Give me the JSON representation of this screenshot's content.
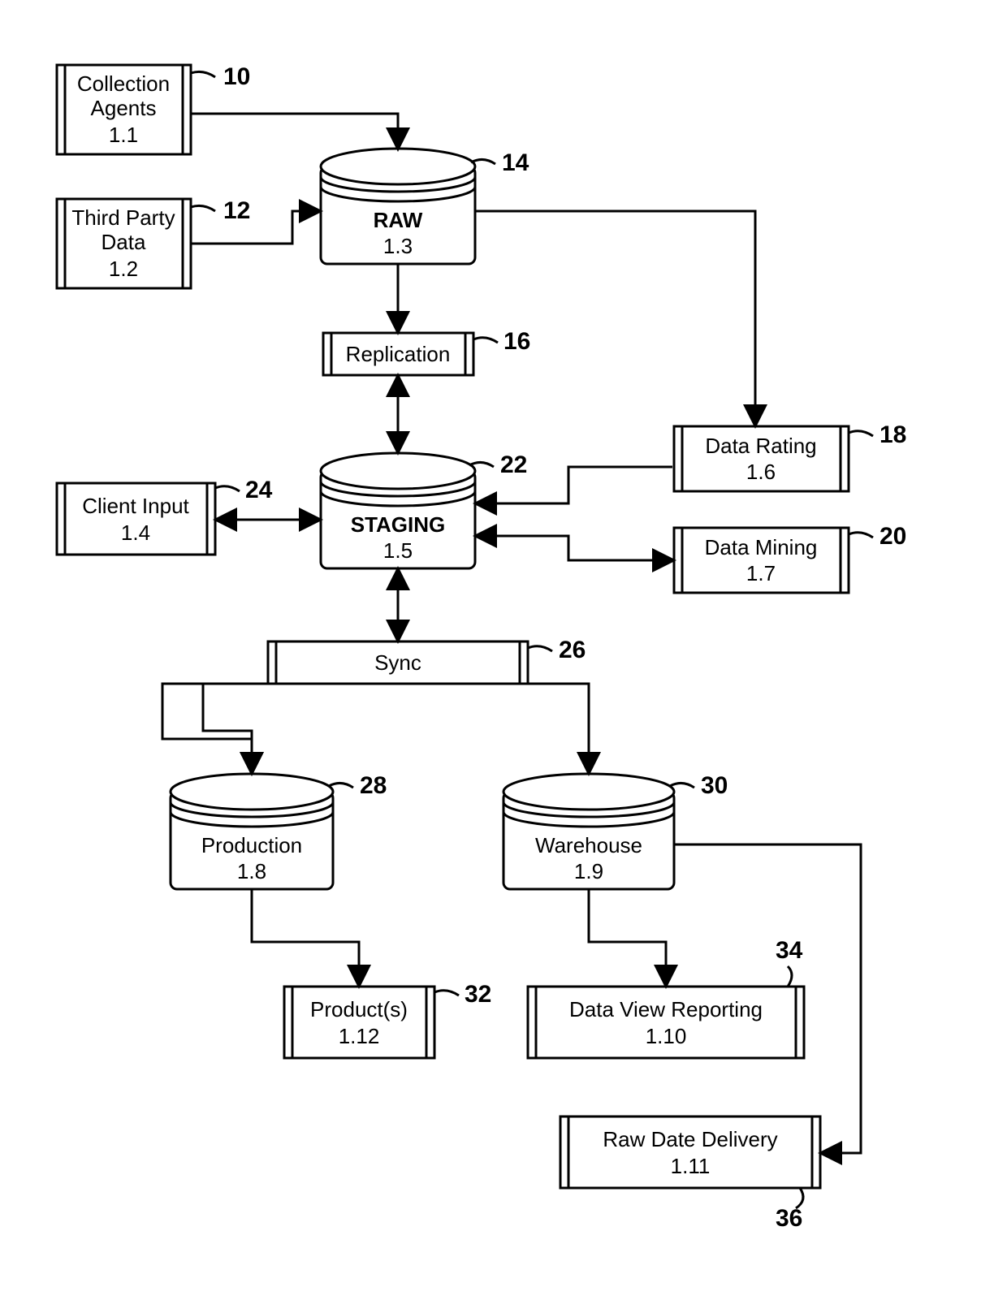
{
  "nodes": {
    "n10": {
      "title": "Collection Agents",
      "sub": "1.1",
      "ref": "10"
    },
    "n12": {
      "title": "Third Party Data",
      "sub": "1.2",
      "ref": "12"
    },
    "n14": {
      "title": "RAW",
      "sub": "1.3",
      "ref": "14"
    },
    "n16": {
      "title": "Replication",
      "ref": "16"
    },
    "n18": {
      "title": "Data Rating",
      "sub": "1.6",
      "ref": "18"
    },
    "n20": {
      "title": "Data Mining",
      "sub": "1.7",
      "ref": "20"
    },
    "n22": {
      "title": "STAGING",
      "sub": "1.5",
      "ref": "22"
    },
    "n24": {
      "title": "Client Input",
      "sub": "1.4",
      "ref": "24"
    },
    "n26": {
      "title": "Sync",
      "ref": "26"
    },
    "n28": {
      "title": "Production",
      "sub": "1.8",
      "ref": "28"
    },
    "n30": {
      "title": "Warehouse",
      "sub": "1.9",
      "ref": "30"
    },
    "n32": {
      "title": "Product(s)",
      "sub": "1.12",
      "ref": "32"
    },
    "n34": {
      "title": "Data View Reporting",
      "sub": "1.10",
      "ref": "34"
    },
    "n36": {
      "title": "Raw Date Delivery",
      "sub": "1.11",
      "ref": "36"
    }
  },
  "edges": [
    {
      "from": "n10",
      "to": "n14",
      "dir": "uni"
    },
    {
      "from": "n12",
      "to": "n14",
      "dir": "uni"
    },
    {
      "from": "n14",
      "to": "n16",
      "dir": "uni"
    },
    {
      "from": "n16",
      "to": "n22",
      "dir": "bi"
    },
    {
      "from": "n24",
      "to": "n22",
      "dir": "bi"
    },
    {
      "from": "n14",
      "to": "n18",
      "dir": "uni"
    },
    {
      "from": "n18",
      "to": "n22",
      "dir": "uni"
    },
    {
      "from": "n20",
      "to": "n22",
      "dir": "bi"
    },
    {
      "from": "n22",
      "to": "n26",
      "dir": "bi"
    },
    {
      "from": "n26",
      "to": "n28",
      "dir": "uni"
    },
    {
      "from": "n26",
      "to": "n30",
      "dir": "uni"
    },
    {
      "from": "n28",
      "to": "n32",
      "dir": "uni"
    },
    {
      "from": "n30",
      "to": "n34",
      "dir": "uni"
    },
    {
      "from": "n30",
      "to": "n36",
      "dir": "uni"
    }
  ]
}
